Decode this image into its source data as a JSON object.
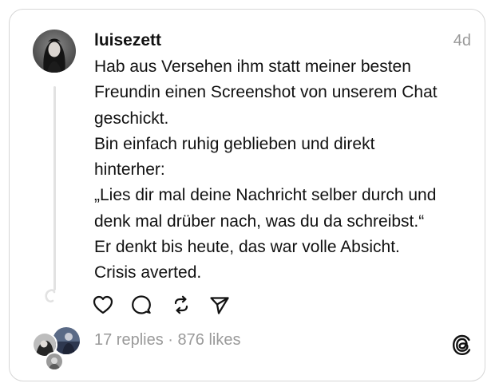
{
  "post": {
    "username": "luisezett",
    "timestamp": "4d",
    "lines": [
      "Hab aus Versehen ihm statt meiner besten",
      "Freundin einen Screenshot von unserem Chat",
      "geschickt.",
      "Bin einfach ruhig geblieben und direkt",
      "hinterher:",
      "„Lies dir mal deine Nachricht selber durch und",
      "denk mal drüber nach, was du da schreibst.“",
      "Er denkt bis heute, das war volle Absicht.",
      "Crisis averted."
    ]
  },
  "actions": {
    "like": "heart-icon",
    "reply": "comment-icon",
    "repost": "repost-icon",
    "share": "send-icon"
  },
  "stats": {
    "replies": "17 replies",
    "separator": "·",
    "likes": "876 likes"
  },
  "colors": {
    "text": "#111111",
    "muted": "#9a9a9a",
    "border": "#d6d6d6",
    "thread_line": "#e2e2e2"
  }
}
